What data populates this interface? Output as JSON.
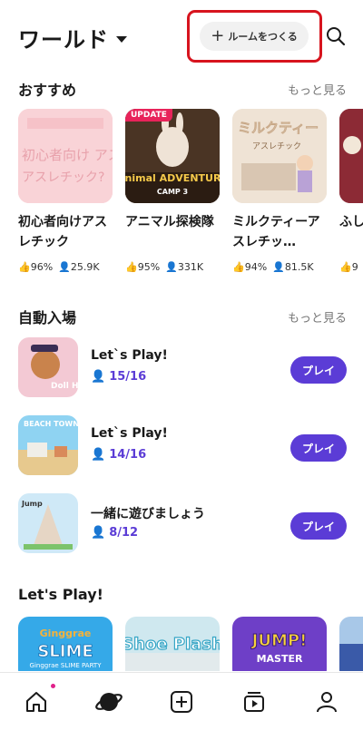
{
  "header": {
    "title": "ワールド",
    "create_label": "ルームをつくる"
  },
  "recommended": {
    "title": "おすすめ",
    "more": "もっと見る",
    "cards": [
      {
        "title": "初心者向けアスレチック",
        "likes": "96%",
        "players": "25.9K",
        "thumb_text": "初心者向け アスレチック?"
      },
      {
        "title": "アニマル探検隊",
        "likes": "95%",
        "players": "331K",
        "badge": "UPDATE",
        "thumb_text": "Animal ADVENTURE",
        "thumb_sub": "CAMP 3"
      },
      {
        "title": "ミルクティーアスレチッ…",
        "likes": "94%",
        "players": "81.5K",
        "thumb_text": "ミルクティー",
        "thumb_sub": "アスレチック"
      },
      {
        "title": "ふしアリ",
        "likes": "9",
        "players": ""
      }
    ]
  },
  "auto_join": {
    "title": "自動入場",
    "more": "もっと見る",
    "rows": [
      {
        "title": "Let`s Play!",
        "count": "15/16",
        "button": "プレイ",
        "thumb_text": "Doll House"
      },
      {
        "title": "Let`s Play!",
        "count": "14/16",
        "button": "プレイ",
        "thumb_text": "BEACH TOWN"
      },
      {
        "title": "一緒に遊びましょう",
        "count": "8/12",
        "button": "プレイ",
        "thumb_text": "Jump"
      }
    ]
  },
  "lets_play": {
    "title": "Let's Play!",
    "thumbs": [
      {
        "label": "Ginggrae SLIME PARTY"
      },
      {
        "label": "Shoe Plash"
      },
      {
        "label": "JUMP! MASTER"
      },
      {
        "label": ""
      }
    ]
  },
  "tabbar": {
    "items": [
      "home-icon",
      "world-icon",
      "create-icon",
      "video-icon",
      "profile-icon"
    ]
  }
}
